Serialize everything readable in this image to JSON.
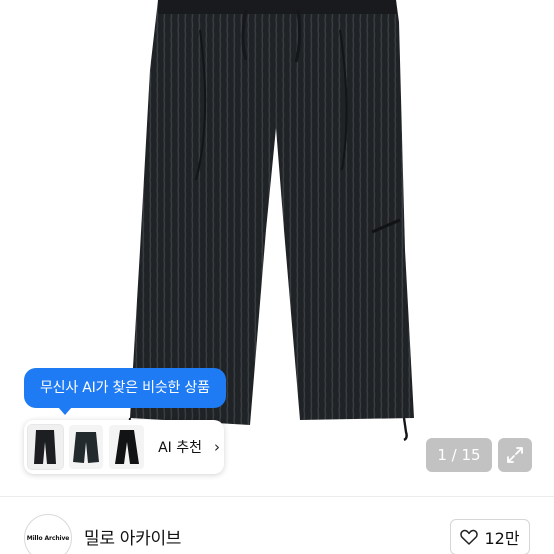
{
  "ai_tooltip": {
    "text": "무신사 AI가 찾은 비슷한 상품"
  },
  "ai_strip": {
    "label": "AI 추천",
    "chevron": "›",
    "thumbnails": [
      "pants-thumbnail",
      "pants-thumbnail",
      "pants-thumbnail"
    ]
  },
  "pager": {
    "text": "1 / 15"
  },
  "expand": {
    "icon": "expand-icon"
  },
  "shop": {
    "logo_text": "Millo Archive",
    "name": "밀로 아카이브"
  },
  "like": {
    "icon": "heart-icon",
    "count": "12만"
  },
  "colors": {
    "accent": "#1e7bf4",
    "product": "#202326"
  }
}
